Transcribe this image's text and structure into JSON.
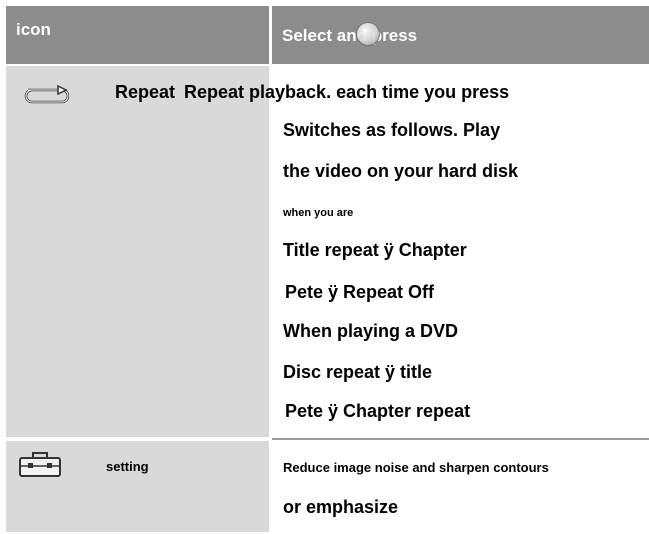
{
  "header": {
    "left": "icon",
    "right": "Select and press"
  },
  "rows": [
    {
      "icon": "repeat-icon",
      "name": "Repeat",
      "lines": [
        "Repeat playback. each time you press",
        "Switches as follows. Play",
        "the video on your hard disk",
        "when you are",
        "Title repeat ÿ Chapter",
        "Pete ÿ Repeat Off",
        "When playing a DVD",
        "Disc repeat ÿ title",
        "Pete ÿ Chapter repeat"
      ]
    },
    {
      "icon": "toolbox-icon",
      "name": "setting",
      "lines": [
        "Reduce image noise and sharpen contours",
        "or emphasize"
      ]
    }
  ],
  "colors": {
    "header_bg": "#8c8c8c",
    "left_col_bg": "#d9d9d9",
    "separator": "#9a9a9a"
  }
}
